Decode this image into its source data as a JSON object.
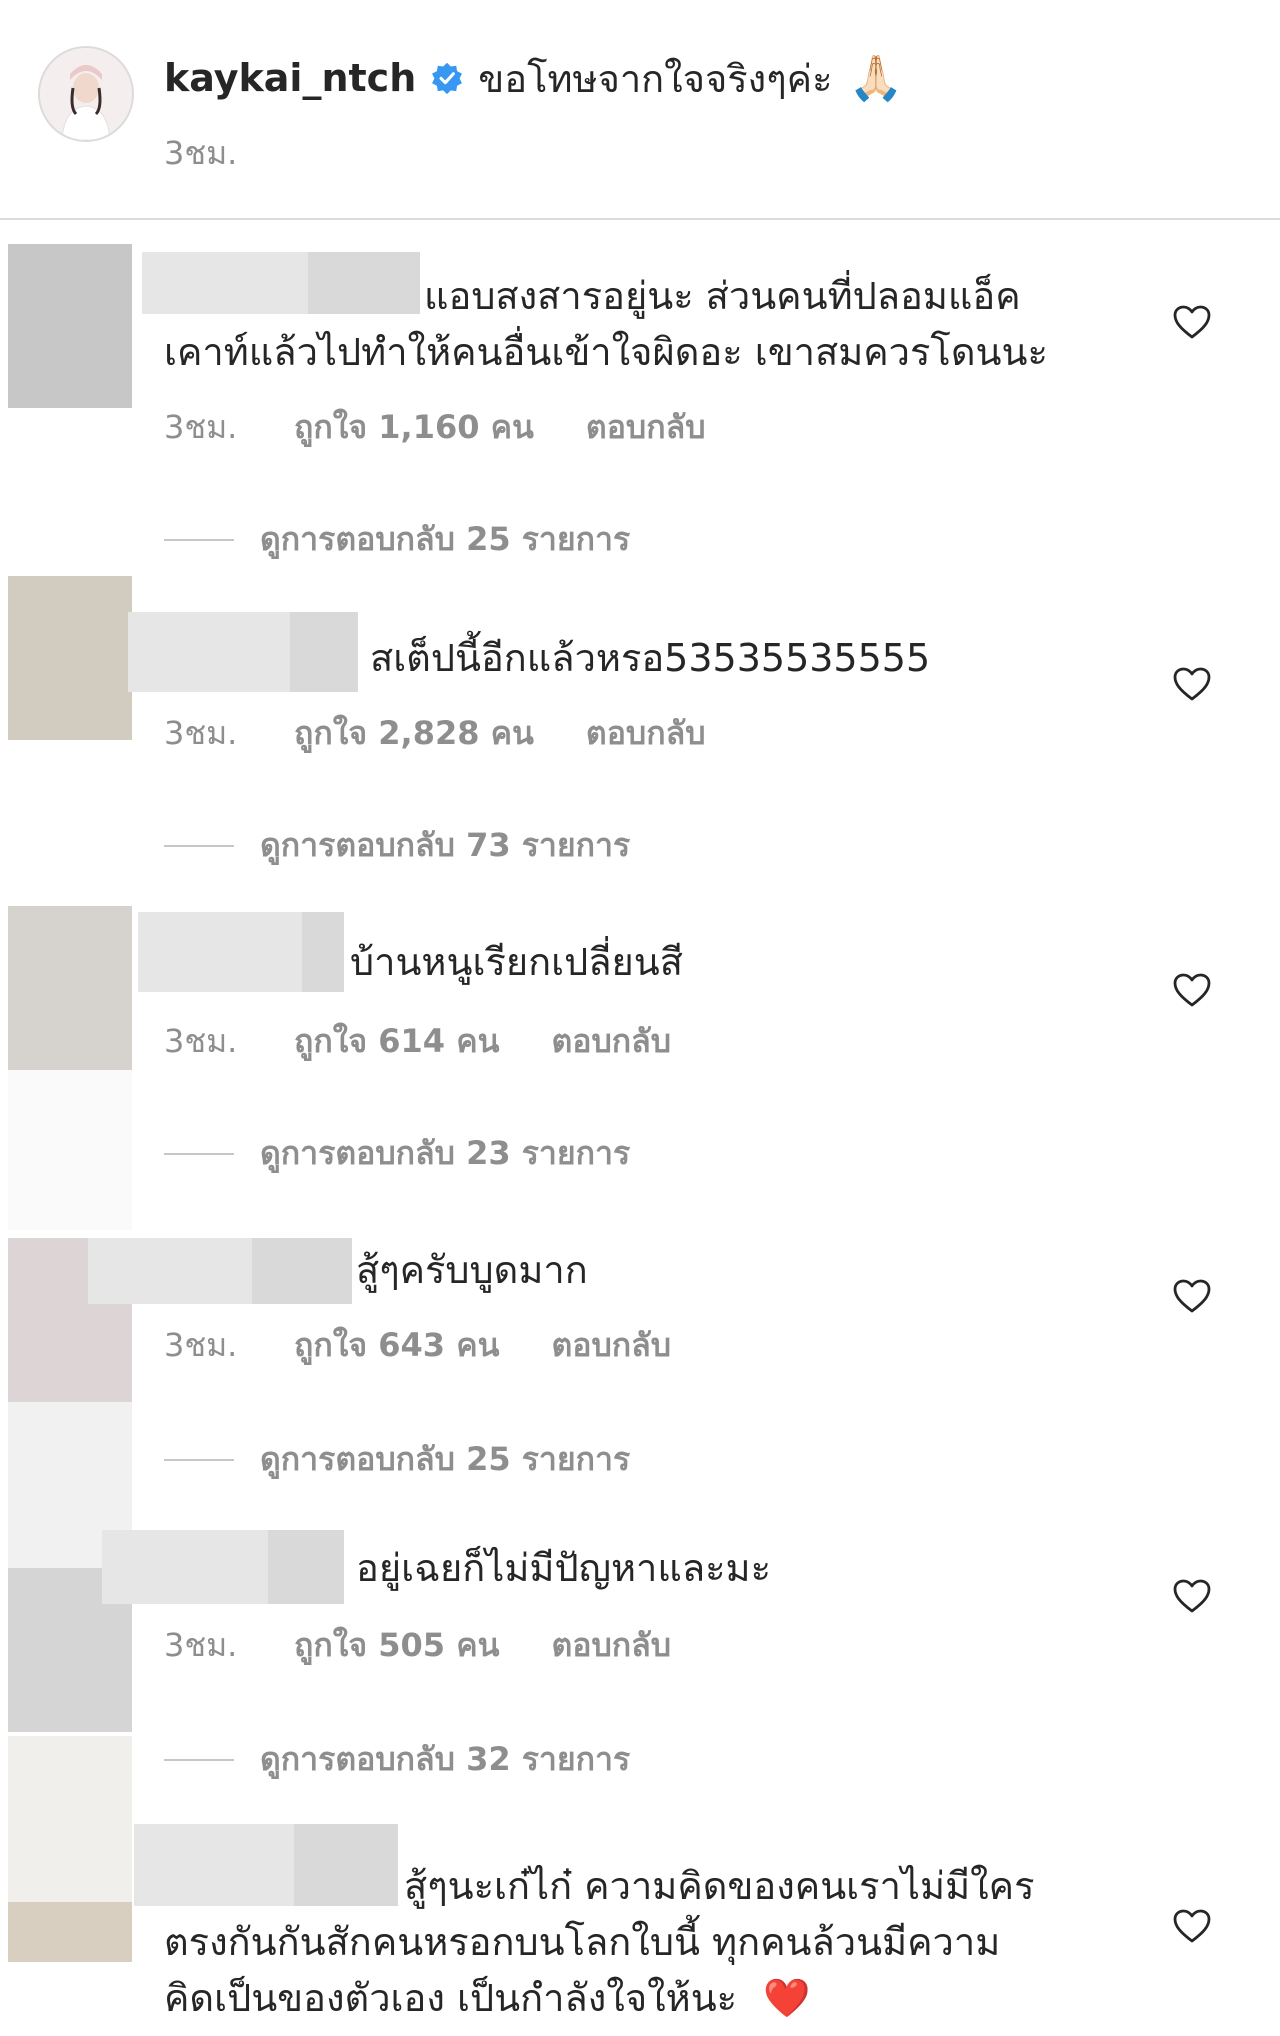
{
  "post": {
    "username": "kaykai_ntch",
    "caption": "ขอโทษจากใจจริงๆค่ะ",
    "caption_emoji": "🙏🏻",
    "time": "3ชม."
  },
  "comments": [
    {
      "lines": [
        "แอบสงสารอยู่นะ ส่วนคนที่ปลอมแอ็ค",
        "เคาท์แล้วไปทำให้คนอื่นเข้าใจผิดอะ เขาสมควรโดนนะ"
      ],
      "time": "3ชม.",
      "likes": "ถูกใจ 1,160 คน",
      "reply": "ตอบกลับ",
      "view_replies": "ดูการตอบกลับ 25 รายการ"
    },
    {
      "lines": [
        "สเต็ปนี้อีกแล้วหรอ53535535555"
      ],
      "time": "3ชม.",
      "likes": "ถูกใจ 2,828 คน",
      "reply": "ตอบกลับ",
      "view_replies": "ดูการตอบกลับ 73 รายการ"
    },
    {
      "lines": [
        "บ้านหนูเรียกเปลี่ยนสี"
      ],
      "time": "3ชม.",
      "likes": "ถูกใจ 614 คน",
      "reply": "ตอบกลับ",
      "view_replies": "ดูการตอบกลับ 23 รายการ"
    },
    {
      "lines": [
        "สู้ๆครับบูดมาก"
      ],
      "time": "3ชม.",
      "likes": "ถูกใจ 643 คน",
      "reply": "ตอบกลับ",
      "view_replies": "ดูการตอบกลับ 25 รายการ"
    },
    {
      "lines": [
        "อยู่เฉยก็ไม่มีปัญหาและมะ"
      ],
      "time": "3ชม.",
      "likes": "ถูกใจ 505 คน",
      "reply": "ตอบกลับ",
      "view_replies": "ดูการตอบกลับ 32 รายการ"
    },
    {
      "lines": [
        "สู้ๆนะเก๋ไก๋ ความคิดของคนเราไม่มีใคร",
        "ตรงกันกันสักคนหรอกบนโลกใบนี้ ทุกคนล้วนมีความ",
        "คิดเป็นของตัวเอง เป็นกำลังใจให้นะ"
      ],
      "end_emoji": "❤️"
    }
  ],
  "colors": {
    "text": "#262626",
    "meta": "#8e8e8e",
    "verified": "#3897f0",
    "divider": "#dbdbdb"
  },
  "icons": [
    "verified-badge-icon",
    "heart-icon"
  ]
}
